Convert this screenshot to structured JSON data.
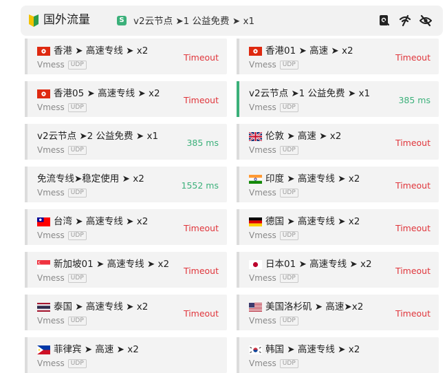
{
  "header": {
    "title": "国外流量",
    "selected_badge": "S",
    "selected_node": "v2云节点 ➤1 公益免费 ➤ x1",
    "icons": [
      "delay-check-icon",
      "wifi-test-icon",
      "hide-unavailable-icon"
    ]
  },
  "proxies": [
    {
      "flag": "hk",
      "name": "香港 ➤ 高速专线 ➤ x2",
      "type": "Vmess",
      "udp": "UDP",
      "delay": "Timeout",
      "status": "timeout"
    },
    {
      "flag": "hk",
      "name": "香港01 ➤ 高速 ➤ x2",
      "type": "Vmess",
      "udp": "UDP",
      "delay": "Timeout",
      "status": "timeout"
    },
    {
      "flag": "hk",
      "name": "香港05 ➤ 高速专线 ➤ x2",
      "type": "Vmess",
      "udp": "UDP",
      "delay": "Timeout",
      "status": "timeout"
    },
    {
      "flag": "",
      "name": "v2云节点 ➤1 公益免费 ➤ x1",
      "type": "Vmess",
      "udp": "UDP",
      "delay": "385 ms",
      "status": "ok",
      "active": true
    },
    {
      "flag": "",
      "name": "v2云节点 ➤2 公益免费 ➤ x1",
      "type": "Vmess",
      "udp": "UDP",
      "delay": "385 ms",
      "status": "ok"
    },
    {
      "flag": "gb",
      "name": "伦敦 ➤ 高速 ➤ x2",
      "type": "Vmess",
      "udp": "UDP",
      "delay": "Timeout",
      "status": "timeout"
    },
    {
      "flag": "",
      "name": "免流专线➤稳定使用 ➤ x2",
      "type": "Vmess",
      "udp": "UDP",
      "delay": "1552 ms",
      "status": "ok"
    },
    {
      "flag": "in",
      "name": "印度 ➤ 高速专线 ➤ x2",
      "type": "Vmess",
      "udp": "UDP",
      "delay": "Timeout",
      "status": "timeout"
    },
    {
      "flag": "tw",
      "name": "台湾 ➤ 高速专线 ➤ x2",
      "type": "Vmess",
      "udp": "UDP",
      "delay": "Timeout",
      "status": "timeout"
    },
    {
      "flag": "de",
      "name": "德国 ➤ 高速专线 ➤ x2",
      "type": "Vmess",
      "udp": "UDP",
      "delay": "Timeout",
      "status": "timeout"
    },
    {
      "flag": "sg",
      "name": "新加坡01 ➤ 高速专线 ➤ x2",
      "type": "Vmess",
      "udp": "UDP",
      "delay": "Timeout",
      "status": "timeout"
    },
    {
      "flag": "jp",
      "name": "日本01 ➤ 高速专线 ➤ x2",
      "type": "Vmess",
      "udp": "UDP",
      "delay": "Timeout",
      "status": "timeout"
    },
    {
      "flag": "th",
      "name": "泰国 ➤ 高速专线 ➤ x2",
      "type": "Vmess",
      "udp": "UDP",
      "delay": "Timeout",
      "status": "timeout"
    },
    {
      "flag": "us",
      "name": "美国洛杉矶 ➤ 高速➤x2",
      "type": "Vmess",
      "udp": "UDP",
      "delay": "Timeout",
      "status": "timeout"
    },
    {
      "flag": "ph",
      "name": "菲律宾 ➤ 高速 ➤ x2",
      "type": "Vmess",
      "udp": "UDP",
      "delay": "",
      "status": "timeout"
    },
    {
      "flag": "kr",
      "name": "韩国 ➤ 高速专线 ➤ x2",
      "type": "Vmess",
      "udp": "UDP",
      "delay": "",
      "status": "timeout"
    }
  ],
  "colors": {
    "accent": "#3bb07a",
    "timeout": "#e0353b",
    "card_bg": "#f3f3f3",
    "header_bg": "#f2f2f2"
  }
}
